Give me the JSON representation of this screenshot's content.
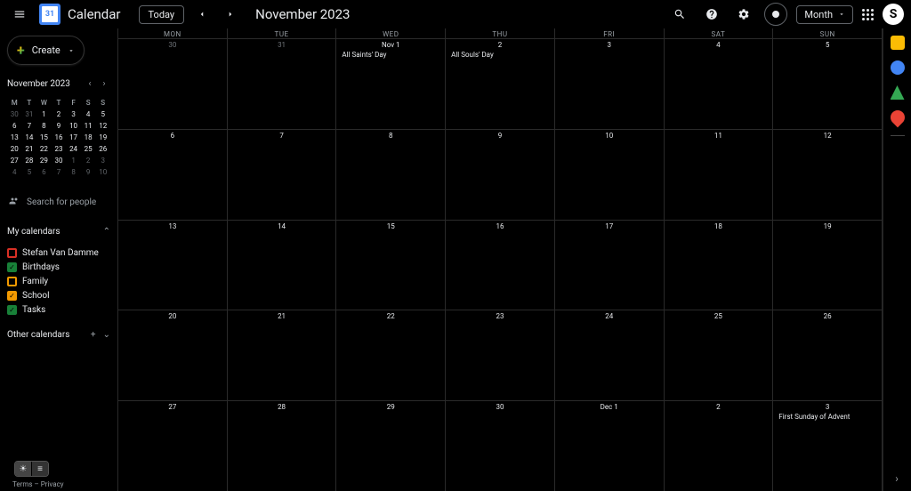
{
  "header": {
    "app_name": "Calendar",
    "today_label": "Today",
    "title": "November 2023",
    "view_label": "Month",
    "avatar_initial": "S"
  },
  "sidebar": {
    "create_label": "Create",
    "mini_title": "November 2023",
    "mini_dow": [
      "M",
      "T",
      "W",
      "T",
      "F",
      "S",
      "S"
    ],
    "mini_days": [
      {
        "n": "30",
        "dim": true
      },
      {
        "n": "31",
        "dim": true
      },
      {
        "n": "1"
      },
      {
        "n": "2"
      },
      {
        "n": "3"
      },
      {
        "n": "4"
      },
      {
        "n": "5"
      },
      {
        "n": "6"
      },
      {
        "n": "7"
      },
      {
        "n": "8"
      },
      {
        "n": "9"
      },
      {
        "n": "10"
      },
      {
        "n": "11"
      },
      {
        "n": "12"
      },
      {
        "n": "13"
      },
      {
        "n": "14"
      },
      {
        "n": "15"
      },
      {
        "n": "16"
      },
      {
        "n": "17"
      },
      {
        "n": "18"
      },
      {
        "n": "19"
      },
      {
        "n": "20"
      },
      {
        "n": "21"
      },
      {
        "n": "22"
      },
      {
        "n": "23"
      },
      {
        "n": "24"
      },
      {
        "n": "25"
      },
      {
        "n": "26"
      },
      {
        "n": "27"
      },
      {
        "n": "28"
      },
      {
        "n": "29"
      },
      {
        "n": "30"
      },
      {
        "n": "1",
        "dim": true
      },
      {
        "n": "2",
        "dim": true
      },
      {
        "n": "3",
        "dim": true
      },
      {
        "n": "4",
        "dim": true
      },
      {
        "n": "5",
        "dim": true
      },
      {
        "n": "6",
        "dim": true
      },
      {
        "n": "7",
        "dim": true
      },
      {
        "n": "8",
        "dim": true
      },
      {
        "n": "9",
        "dim": true
      },
      {
        "n": "10",
        "dim": true
      }
    ],
    "search_people": "Search for people",
    "my_calendars": "My calendars",
    "calendars": [
      {
        "label": "Stefan Van Damme",
        "color": "#d93025",
        "checked": false
      },
      {
        "label": "Birthdays",
        "color": "#188038",
        "checked": true
      },
      {
        "label": "Family",
        "color": "#f29900",
        "checked": false
      },
      {
        "label": "School",
        "color": "#f29900",
        "checked": true
      },
      {
        "label": "Tasks",
        "color": "#188038",
        "checked": true
      }
    ],
    "other_calendars": "Other calendars"
  },
  "grid": {
    "dow": [
      "MON",
      "TUE",
      "WED",
      "THU",
      "FRI",
      "SAT",
      "SUN"
    ],
    "weeks": [
      [
        {
          "date": "30",
          "dim": true
        },
        {
          "date": "31",
          "dim": true
        },
        {
          "date": "Nov 1",
          "events": [
            "All Saints' Day"
          ]
        },
        {
          "date": "2",
          "events": [
            "All Souls' Day"
          ]
        },
        {
          "date": "3"
        },
        {
          "date": "4"
        },
        {
          "date": "5"
        }
      ],
      [
        {
          "date": "6"
        },
        {
          "date": "7"
        },
        {
          "date": "8"
        },
        {
          "date": "9"
        },
        {
          "date": "10"
        },
        {
          "date": "11"
        },
        {
          "date": "12"
        }
      ],
      [
        {
          "date": "13"
        },
        {
          "date": "14"
        },
        {
          "date": "15"
        },
        {
          "date": "16"
        },
        {
          "date": "17"
        },
        {
          "date": "18"
        },
        {
          "date": "19"
        }
      ],
      [
        {
          "date": "20"
        },
        {
          "date": "21"
        },
        {
          "date": "22"
        },
        {
          "date": "23"
        },
        {
          "date": "24"
        },
        {
          "date": "25"
        },
        {
          "date": "26"
        }
      ],
      [
        {
          "date": "27"
        },
        {
          "date": "28"
        },
        {
          "date": "29"
        },
        {
          "date": "30"
        },
        {
          "date": "Dec 1"
        },
        {
          "date": "2"
        },
        {
          "date": "3",
          "events": [
            "First Sunday of Advent"
          ]
        }
      ]
    ]
  },
  "footer": {
    "terms": "Terms",
    "privacy": "Privacy",
    "sep": " – "
  }
}
